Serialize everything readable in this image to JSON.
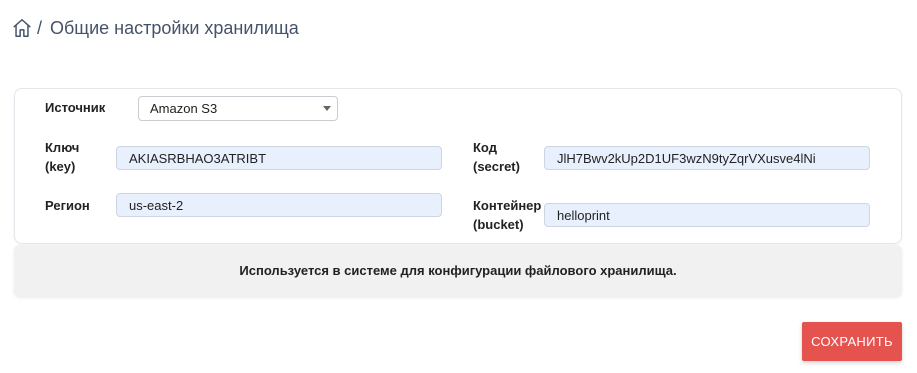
{
  "header": {
    "home_icon": "home-icon",
    "separator": "/",
    "title": "Общие настройки хранилища"
  },
  "form": {
    "source": {
      "label": "Источник",
      "value": "Amazon S3"
    },
    "key": {
      "label_line1": "Ключ",
      "label_line2": "(key)",
      "value": "AKIASRBHAO3ATRIBT"
    },
    "secret": {
      "label_line1": "Код",
      "label_line2": "(secret)",
      "value": "JlH7Bwv2kUp2D1UF3wzN9tyZqrVXusve4lNi"
    },
    "region": {
      "label": "Регион",
      "value": "us-east-2"
    },
    "bucket": {
      "label_line1": "Контейнер",
      "label_line2": "(bucket)",
      "value": "helloprint"
    }
  },
  "info": {
    "text": "Используется в системе для конфигурации файлового хранилища."
  },
  "actions": {
    "save_label": "СОХРАНИТЬ"
  },
  "colors": {
    "accent": "#e5534f",
    "title_text": "#44526a",
    "input_bg": "#e8f0fe",
    "info_bg": "#f1f1f1"
  }
}
